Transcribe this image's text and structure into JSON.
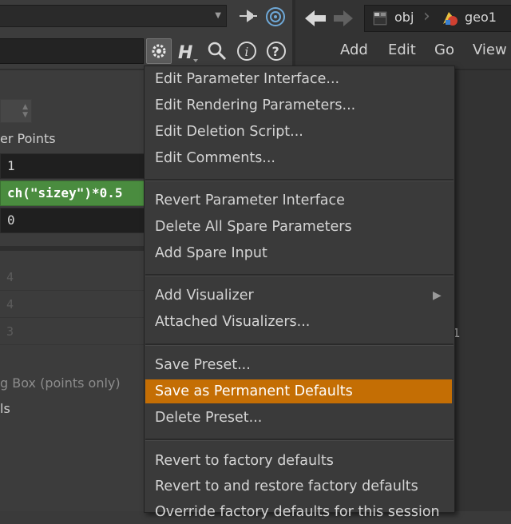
{
  "parameter_pane": {
    "points_label": "er Points",
    "param_rows": [
      "1",
      "ch(\"sizey\")*0.5",
      "0"
    ],
    "dimmed_values": [
      "4",
      "4",
      "3"
    ],
    "bounding_box_label": "g Box (points only)",
    "label_suffix": "ls"
  },
  "toolbar": {
    "icons": [
      "gear-icon",
      "help-h-icon",
      "search-icon",
      "info-icon",
      "question-icon"
    ]
  },
  "network_pane": {
    "path": [
      "obj",
      "geo1"
    ],
    "menubar": [
      "Add",
      "Edit",
      "Go",
      "View"
    ],
    "stray_text": "1"
  },
  "context_menu": {
    "groups": [
      [
        "Edit Parameter Interface...",
        "Edit Rendering Parameters...",
        "Edit Deletion Script...",
        "Edit Comments..."
      ],
      [
        "Revert Parameter Interface",
        "Delete All Spare Parameters",
        "Add Spare Input"
      ],
      [
        "Add Visualizer",
        "Attached Visualizers..."
      ],
      [
        "Save Preset...",
        "Save as Permanent Defaults",
        "Delete Preset..."
      ],
      [
        "Revert to factory defaults",
        "Revert to and restore factory defaults",
        "Override factory defaults for this session"
      ]
    ],
    "highlighted": "Save as Permanent Defaults",
    "submenu_arrow": "▶"
  },
  "colors": {
    "highlight": "#c46e04",
    "expression_bg": "#4a8c3f",
    "pane_bg": "#3c3c3c"
  }
}
